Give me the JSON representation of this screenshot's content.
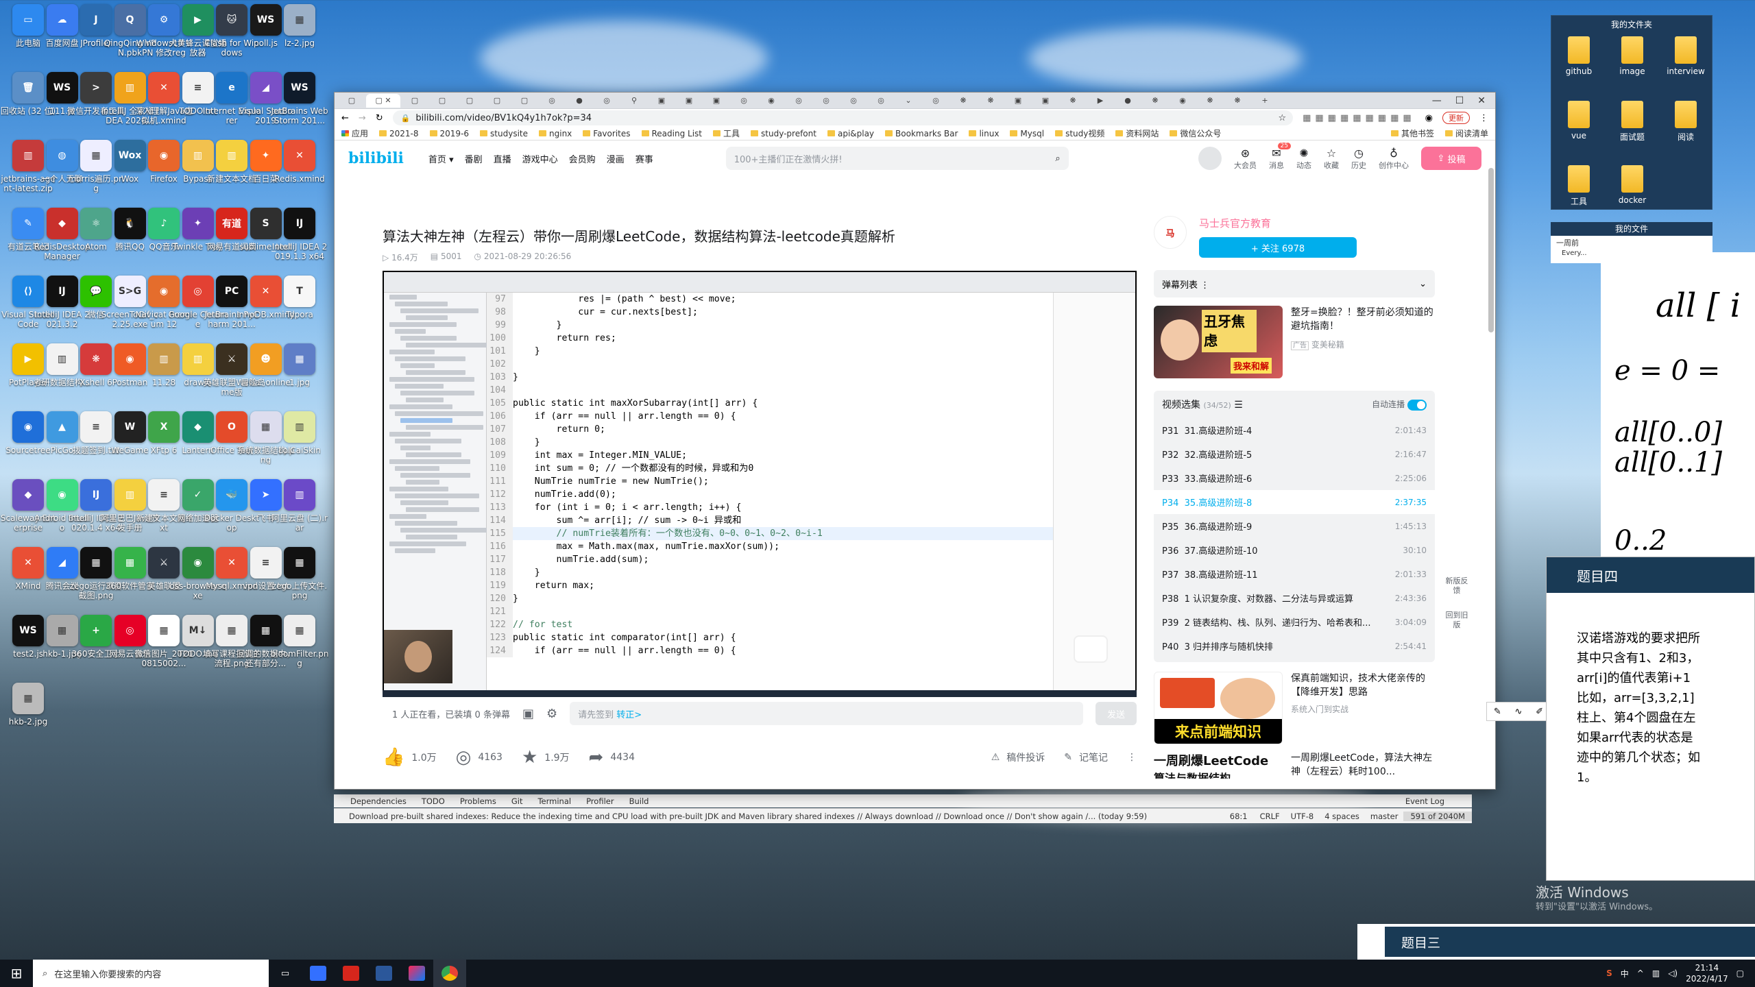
{
  "desktop": {
    "icons": [
      {
        "label": "此电脑",
        "color": "#2d89ef",
        "glyph": "▭"
      },
      {
        "label": "百度网盘",
        "color": "#3a7cf0",
        "glyph": "☁"
      },
      {
        "label": "JProfiler",
        "color": "#2b6cb0",
        "glyph": "J"
      },
      {
        "label": "QingQing VPN.pbk",
        "color": "#4a6fa5",
        "glyph": "Q"
      },
      {
        "label": "Windows10 VPN 修改reg",
        "color": "#3578d6",
        "glyph": "⚙"
      },
      {
        "label": "大黄蜂云课堂播放器",
        "color": "#1f8f5f",
        "glyph": "▶"
      },
      {
        "label": "Clash for Windows",
        "color": "#333c4a",
        "glyph": "🐱"
      },
      {
        "label": "poll.js",
        "color": "#1a1a1a",
        "glyph": "WS"
      },
      {
        "label": "lz-2.jpg",
        "color": "#9bb0c8",
        "glyph": "▦"
      },
      {
        "label": "回收站 (32 位)",
        "color": "#5b8fc7",
        "glyph": "🗑"
      },
      {
        "label": "111.js",
        "color": "#111",
        "glyph": "WS"
      },
      {
        "label": "微信开发者工具",
        "color": "#3c3c3c",
        "glyph": "&gt;"
      },
      {
        "label": "IntelliJ 全家桶 IDEA 2020...",
        "color": "#f0a31b",
        "glyph": "▥"
      },
      {
        "label": "深入理解Java虚拟机.xmind",
        "color": "#e94f35",
        "glyph": "✕"
      },
      {
        "label": "TODO.txt",
        "color": "#f2f2f2",
        "glyph": "≡"
      },
      {
        "label": "Internet Explorer",
        "color": "#1c75c9",
        "glyph": "e"
      },
      {
        "label": "Visual Studio 2019",
        "color": "#7a4fc7",
        "glyph": "◢"
      },
      {
        "label": "JetBrains WebStorm 201...",
        "color": "#0f1b2b",
        "glyph": "WS"
      },
      {
        "label": "jetbrains-agent-latest.zip",
        "color": "#c53b3b",
        "glyph": "▥"
      },
      {
        "label": "一个人无聊",
        "color": "#3e8de0",
        "glyph": "◍"
      },
      {
        "label": "morris遍历.png",
        "color": "#eef",
        "glyph": "▦"
      },
      {
        "label": "Wox",
        "color": "#2d6e9e",
        "glyph": "Wox"
      },
      {
        "label": "Firefox",
        "color": "#e8662b",
        "glyph": "◉"
      },
      {
        "label": "Bypass",
        "color": "#f2c14e",
        "glyph": "▥"
      },
      {
        "label": "新建文本文档",
        "color": "#f4d03f",
        "glyph": "▥"
      },
      {
        "label": "百日菜",
        "color": "#ff6a1f",
        "glyph": "✦"
      },
      {
        "label": "Redis.xmind",
        "color": "#e94f35",
        "glyph": "✕"
      },
      {
        "label": "有道云笔记",
        "color": "#3a8cf2",
        "glyph": "✎"
      },
      {
        "label": "RedisDesktopManager",
        "color": "#c9302c",
        "glyph": "◆"
      },
      {
        "label": "Atom",
        "color": "#4ea58b",
        "glyph": "⚛"
      },
      {
        "label": "腾讯QQ",
        "color": "#111",
        "glyph": "🐧"
      },
      {
        "label": "QQ音乐",
        "color": "#31c27c",
        "glyph": "♪"
      },
      {
        "label": "Twinkle Tray",
        "color": "#6c3fb5",
        "glyph": "✦"
      },
      {
        "label": "网易有道词典",
        "color": "#d7261c",
        "glyph": "有道"
      },
      {
        "label": "sublime_text",
        "color": "#2f2f2f",
        "glyph": "S"
      },
      {
        "label": "IntelliJ IDEA 2019.1.3 x64",
        "color": "#111",
        "glyph": "IJ"
      },
      {
        "label": "Visual Studio Code",
        "color": "#1e88e5",
        "glyph": "⟨⟩"
      },
      {
        "label": "IntelliJ IDEA 2021.3.2",
        "color": "#111",
        "glyph": "IJ"
      },
      {
        "label": "微信",
        "color": "#2dc100",
        "glyph": "💬"
      },
      {
        "label": "ScreenToGif_v2.25.exe",
        "color": "#eef",
        "glyph": "S&gt;G"
      },
      {
        "label": "Navicat Premium 12",
        "color": "#e56d2c",
        "glyph": "◉"
      },
      {
        "label": "Google Chrome",
        "color": "#e34133",
        "glyph": "◎"
      },
      {
        "label": "JetBrains PyCharm 201...",
        "color": "#111",
        "glyph": "PC"
      },
      {
        "label": "InnoDB.xmind",
        "color": "#e94f35",
        "glyph": "✕"
      },
      {
        "label": "Typora",
        "color": "#f7f7f7",
        "glyph": "T"
      },
      {
        "label": "PotPlayer",
        "color": "#f2c000",
        "glyph": "▶"
      },
      {
        "label": "考研数据结构...",
        "color": "#f2f2f2",
        "glyph": "▥"
      },
      {
        "label": "Xshell 6",
        "color": "#d63b3b",
        "glyph": "❋"
      },
      {
        "label": "Postman",
        "color": "#ef5b25",
        "glyph": "◉"
      },
      {
        "label": "11.28",
        "color": "#c99a4a",
        "glyph": "▥"
      },
      {
        "label": "drawio",
        "color": "#f4d03f",
        "glyph": "▥"
      },
      {
        "label": "英雄联盟WeGame版",
        "color": "#3b3020",
        "glyph": "⚔"
      },
      {
        "label": "冒险岛online",
        "color": "#f29e22",
        "glyph": "☻"
      },
      {
        "label": "1.jpg",
        "color": "#5f7ec7",
        "glyph": "▦"
      },
      {
        "label": "Sourcetree",
        "color": "#1f6fd9",
        "glyph": "◉"
      },
      {
        "label": "PicGo",
        "color": "#3f9ae0",
        "glyph": "▲"
      },
      {
        "label": "拨题签到.txt",
        "color": "#f2f2f2",
        "glyph": "≡"
      },
      {
        "label": "WeGame",
        "color": "#222",
        "glyph": "W"
      },
      {
        "label": "XFtp 6",
        "color": "#3fa54a",
        "glyph": "X"
      },
      {
        "label": "Lantern",
        "color": "#1a8f72",
        "glyph": "◆"
      },
      {
        "label": "Office Tool",
        "color": "#e44b2a",
        "glyph": "O"
      },
      {
        "label": "系统数据结构.png",
        "color": "#dde",
        "glyph": "▦"
      },
      {
        "label": "LolCaiSkin",
        "color": "#dfe9a4",
        "glyph": "▥"
      },
      {
        "label": "Scaleway Enterprise",
        "color": "#6a4fbf",
        "glyph": "◆"
      },
      {
        "label": "Android Studio",
        "color": "#3ddc84",
        "glyph": "◉"
      },
      {
        "label": "IntelliJ IDEA 2020.1.4 x64",
        "color": "#3a6fdc",
        "glyph": "IJ"
      },
      {
        "label": "阿里巴巴Java开发手册",
        "color": "#f4d03f",
        "glyph": "▥"
      },
      {
        "label": "新建文本文档.txt",
        "color": "#f2f2f2",
        "glyph": "≡"
      },
      {
        "label": "网络加速器",
        "color": "#3aa66a",
        "glyph": "✓"
      },
      {
        "label": "Docker Desktop",
        "color": "#2496ed",
        "glyph": "🐳"
      },
      {
        "label": "飞书",
        "color": "#3370ff",
        "glyph": "➤"
      },
      {
        "label": "阿里云盘 (二).rar",
        "color": "#6b4ac8",
        "glyph": "▥"
      },
      {
        "label": "XMind",
        "color": "#e94f35",
        "glyph": "✕"
      },
      {
        "label": "腾讯会议",
        "color": "#2f7cf6",
        "glyph": "◢"
      },
      {
        "label": "zego运行项目截图.png",
        "color": "#111",
        "glyph": "▦"
      },
      {
        "label": "360软件管家",
        "color": "#36b34a",
        "glyph": "▦"
      },
      {
        "label": "英雄联盟",
        "color": "#2d3642",
        "glyph": "⚔"
      },
      {
        "label": "oss-browser.exe",
        "color": "#2b8a3e",
        "glyph": "◉"
      },
      {
        "label": "Mysql.xmind",
        "color": "#e94f35",
        "glyph": "✕"
      },
      {
        "label": "vpn设置.txt",
        "color": "#f2f2f2",
        "glyph": "≡"
      },
      {
        "label": "zego上传文件.png",
        "color": "#111",
        "glyph": "▦"
      },
      {
        "label": "test2.js",
        "color": "#111",
        "glyph": "WS"
      },
      {
        "label": "hkb-1.jpg",
        "color": "#aaa",
        "glyph": "▦"
      },
      {
        "label": "360安全卫士",
        "color": "#2aa846",
        "glyph": "+"
      },
      {
        "label": "网易云音乐",
        "color": "#e60026",
        "glyph": "◎"
      },
      {
        "label": "微信图片_20200815002...",
        "color": "#fff",
        "glyph": "▦"
      },
      {
        "label": "TODO.md",
        "color": "#ddd",
        "glyph": "M↓"
      },
      {
        "label": "填写课程报告主流程.png",
        "color": "#eee",
        "glyph": "▦"
      },
      {
        "label": "回调的数据中，还有部分...",
        "color": "#111",
        "glyph": "▦"
      },
      {
        "label": "bloomFilter.png",
        "color": "#eee",
        "glyph": "▦"
      },
      {
        "label": "hkb-2.jpg",
        "color": "#bbb",
        "glyph": "▦"
      }
    ]
  },
  "browser": {
    "url": "bilibili.com/video/BV1kQ4y1h7ok?p=34",
    "bookmarks": [
      "应用",
      "2021-8",
      "2019-6",
      "studysite",
      "nginx",
      "Favorites",
      "Reading List",
      "工具",
      "study-prefont",
      "api&play",
      "Bookmarks Bar",
      "linux",
      "Mysql",
      "study视频",
      "资料网站",
      "微信公众号",
      "其他书签",
      "阅读清单"
    ],
    "update_label": "更新"
  },
  "bili": {
    "logo": "bilibili",
    "nav": [
      "首页",
      "番剧",
      "直播",
      "游戏中心",
      "会员购",
      "漫画",
      "赛事"
    ],
    "search_placeholder": "100+主播们正在激情火拼!",
    "icons": [
      "大会员",
      "消息",
      "动态",
      "收藏",
      "历史",
      "创作中心"
    ],
    "msg_badge": "25",
    "upload": "投稿",
    "title": "算法大神左神（左程云）带你一周刷爆LeetCode，数据结构算法-leetcode真题解析",
    "views": "16.4万",
    "danmaku_count": "5001",
    "date": "2021-08-29 20:26:56",
    "viewers": "1 人正在看，已装填 0 条弹幕",
    "danmu_placeholder": "请先签到",
    "danmu_link": "转正>",
    "send": "发送",
    "likes": "1.0万",
    "coins": "4163",
    "favs": "1.9万",
    "shares": "4434",
    "report": "稿件投诉",
    "notes": "记笔记",
    "uploader": "马士兵官方教育",
    "follow": "+ 关注 6978",
    "danmaku_list": "弹幕列表",
    "ad_title": "整牙=换脸？！整牙前必须知道的避坑指南！",
    "ad_tag": "广告",
    "ad_source": "变美秘籍",
    "ad_img_text1": "丑牙焦虑",
    "ad_img_text2": "我来和解",
    "playlist_title": "视频选集",
    "playlist_count": "(34/52)",
    "autoplay": "自动连播",
    "episodes": [
      {
        "p": "P31",
        "name": "31.高级进阶班-4",
        "t": "2:01:43"
      },
      {
        "p": "P32",
        "name": "32.高级进阶班-5",
        "t": "2:16:47"
      },
      {
        "p": "P33",
        "name": "33.高级进阶班-6",
        "t": "2:25:06"
      },
      {
        "p": "P34",
        "name": "35.高级进阶班-8",
        "t": "2:37:35"
      },
      {
        "p": "P35",
        "name": "36.高级进阶班-9",
        "t": "1:45:13"
      },
      {
        "p": "P36",
        "name": "37.高级进阶班-10",
        "t": "30:10"
      },
      {
        "p": "P37",
        "name": "38.高级进阶班-11",
        "t": "2:01:33"
      },
      {
        "p": "P38",
        "name": "1 认识复杂度、对数器、二分法与异或运算",
        "t": "2:43:36"
      },
      {
        "p": "P39",
        "name": "2 链表结构、栈、队列、递归行为、哈希表和...",
        "t": "3:04:09"
      },
      {
        "p": "P40",
        "name": "3 归并排序与随机快排",
        "t": "2:54:41"
      }
    ],
    "rec1_title": "保真前端知识，技术大佬亲传的【降维开发】思路",
    "rec1_source": "系统入门到实战",
    "rec1_img": "来点前端知识",
    "rec2_title": "一周刷爆LeetCode，算法大神左神（左程云）耗时100...",
    "rec2_img": "一周刷爆LeetCode",
    "rec2_img2": "算法与数据结构",
    "feedback": "新版反馈",
    "back_old": "回到旧版"
  },
  "code": [
    {
      "n": "97",
      "c": "            res |= (path ^ best) << move;"
    },
    {
      "n": "98",
      "c": "            cur = cur.nexts[best];"
    },
    {
      "n": "99",
      "c": "        }"
    },
    {
      "n": "100",
      "c": "        return res;"
    },
    {
      "n": "101",
      "c": "    }"
    },
    {
      "n": "102",
      "c": ""
    },
    {
      "n": "103",
      "c": "}"
    },
    {
      "n": "104",
      "c": ""
    },
    {
      "n": "105",
      "c": "public static int maxXorSubarray(int[] arr) {"
    },
    {
      "n": "106",
      "c": "    if (arr == null || arr.length == 0) {"
    },
    {
      "n": "107",
      "c": "        return 0;"
    },
    {
      "n": "108",
      "c": "    }"
    },
    {
      "n": "109",
      "c": "    int max = Integer.MIN_VALUE;"
    },
    {
      "n": "110",
      "c": "    int sum = 0; // 一个数都没有的时候，异或和为0"
    },
    {
      "n": "111",
      "c": "    NumTrie numTrie = new NumTrie();"
    },
    {
      "n": "112",
      "c": "    numTrie.add(0);"
    },
    {
      "n": "113",
      "c": "    for (int i = 0; i < arr.length; i++) {"
    },
    {
      "n": "114",
      "c": "        sum ^= arr[i]; // sum -> 0~i 异或和"
    },
    {
      "n": "115",
      "c": "        // numTrie装着所有：一个数也没有、0~0、0~1、0~2、0~i-1"
    },
    {
      "n": "116",
      "c": "        max = Math.max(max, numTrie.maxXor(sum));"
    },
    {
      "n": "117",
      "c": "        numTrie.add(sum);"
    },
    {
      "n": "118",
      "c": "    }"
    },
    {
      "n": "119",
      "c": "    return max;"
    },
    {
      "n": "120",
      "c": "}"
    },
    {
      "n": "121",
      "c": ""
    },
    {
      "n": "122",
      "c": "// for test"
    },
    {
      "n": "123",
      "c": "public static int comparator(int[] arr) {"
    },
    {
      "n": "124",
      "c": "    if (arr == null || arr.length == 0) {"
    }
  ],
  "ide": {
    "tabs": [
      "Dependencies",
      "TODO",
      "Problems",
      "Git",
      "Terminal",
      "Profiler",
      "Build"
    ],
    "event_log": "Event Log",
    "status": "Download pre-built shared indexes: Reduce the indexing time and CPU load with pre-built JDK and Maven library shared indexes // Always download // Download once // Don't show again /... (today 9:59)",
    "pos": "68:1",
    "crlf": "CRLF",
    "enc": "UTF-8",
    "indent": "4 spaces",
    "branch": "master",
    "mem": "591 of 2040M"
  },
  "folders": {
    "header": "我的文件夹",
    "items": [
      "github",
      "image",
      "interview",
      "vue",
      "面试题",
      "阅读",
      "工具",
      "docker"
    ],
    "docs_header": "我的文件",
    "doc_line1": "一周前",
    "doc_line2": "Every..."
  },
  "notes_lines": [
    "all [ i",
    "e = 0 =",
    "all[0..0]",
    "all[0..1]",
    "0..2"
  ],
  "problem4": {
    "title": "题目四",
    "lines": [
      "汉诺塔游戏的要求把所",
      "其中只含有1、2和3，",
      "arr[i]的值代表第i+1",
      "比如，arr=[3,3,2,1]",
      "柱上、第4个圆盘在左",
      "如果arr代表的状态是",
      "迹中的第几个状态；如",
      "1。"
    ]
  },
  "problem3": {
    "title": "题目三"
  },
  "watermark": {
    "l1": "激活 Windows",
    "l2": "转到\"设置\"以激活 Windows。"
  },
  "taskbar": {
    "search": "在这里输入你要搜索的内容",
    "time": "21:14",
    "date": "2022/4/17",
    "lang": "中"
  }
}
